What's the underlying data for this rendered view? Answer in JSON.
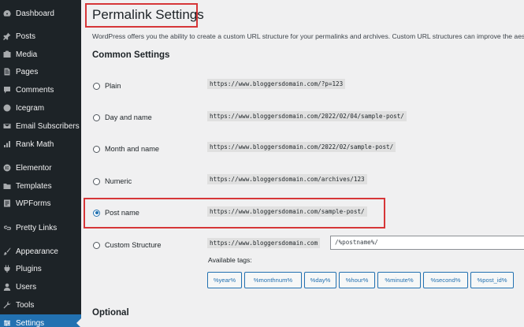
{
  "sidebar": {
    "items": [
      {
        "label": "Dashboard",
        "icon": "dashboard-icon"
      },
      {
        "label": "Posts",
        "icon": "pin-icon"
      },
      {
        "label": "Media",
        "icon": "media-icon"
      },
      {
        "label": "Pages",
        "icon": "page-icon"
      },
      {
        "label": "Comments",
        "icon": "comment-icon"
      },
      {
        "label": "Icegram",
        "icon": "icegram-icon"
      },
      {
        "label": "Email Subscribers",
        "icon": "email-icon"
      },
      {
        "label": "Rank Math",
        "icon": "chart-icon"
      },
      {
        "label": "Elementor",
        "icon": "elementor-icon"
      },
      {
        "label": "Templates",
        "icon": "folder-icon"
      },
      {
        "label": "WPForms",
        "icon": "forms-icon"
      },
      {
        "label": "Pretty Links",
        "icon": "link-icon"
      },
      {
        "label": "Appearance",
        "icon": "brush-icon"
      },
      {
        "label": "Plugins",
        "icon": "plugin-icon"
      },
      {
        "label": "Users",
        "icon": "user-icon"
      },
      {
        "label": "Tools",
        "icon": "wrench-icon"
      },
      {
        "label": "Settings",
        "icon": "settings-icon"
      }
    ],
    "active": "Settings"
  },
  "page": {
    "title": "Permalink Settings",
    "intro": "WordPress offers you the ability to create a custom URL structure for your permalinks and archives. Custom URL structures can improve the aest",
    "common_heading": "Common Settings",
    "optional_heading": "Optional"
  },
  "options": [
    {
      "label": "Plain",
      "example": "https://www.bloggersdomain.com/?p=123",
      "checked": false
    },
    {
      "label": "Day and name",
      "example": "https://www.bloggersdomain.com/2022/02/04/sample-post/",
      "checked": false
    },
    {
      "label": "Month and name",
      "example": "https://www.bloggersdomain.com/2022/02/sample-post/",
      "checked": false
    },
    {
      "label": "Numeric",
      "example": "https://www.bloggersdomain.com/archives/123",
      "checked": false
    },
    {
      "label": "Post name",
      "example": "https://www.bloggersdomain.com/sample-post/",
      "checked": true
    },
    {
      "label": "Custom Structure",
      "example": "https://www.bloggersdomain.com",
      "checked": false
    }
  ],
  "custom_structure": {
    "value": "/%postname%/",
    "available_tags_label": "Available tags:",
    "tags": [
      "%year%",
      "%monthnum%",
      "%day%",
      "%hour%",
      "%minute%",
      "%second%",
      "%post_id%"
    ]
  },
  "colors": {
    "sidebar_bg": "#1d2327",
    "accent": "#2271b1",
    "highlight_border": "#d63638"
  }
}
